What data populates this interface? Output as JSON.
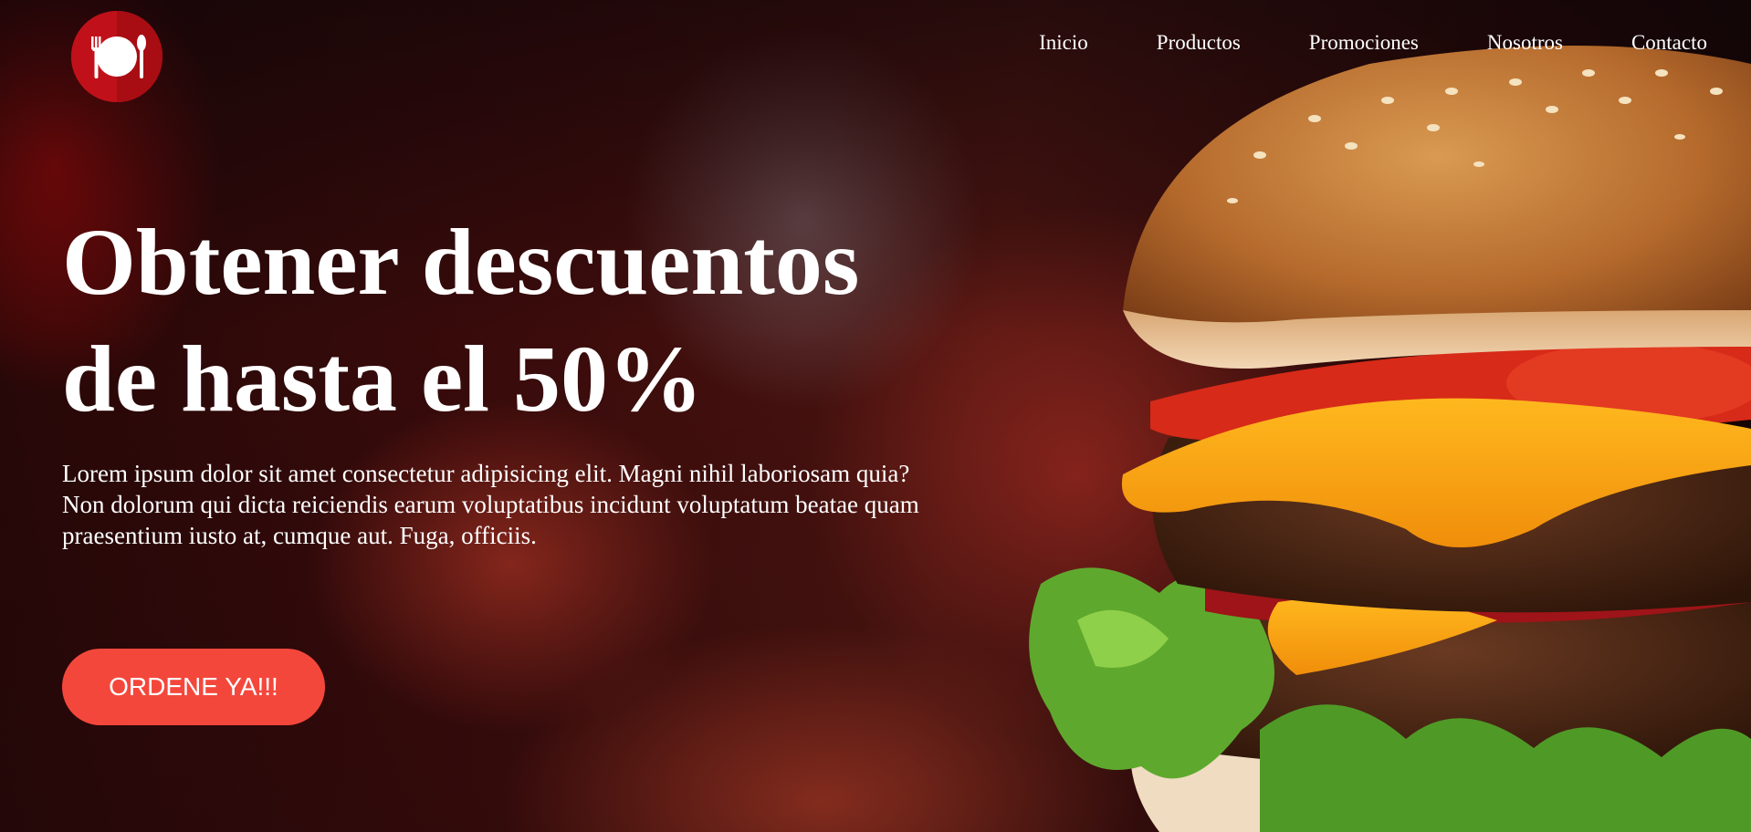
{
  "brand": {
    "logo_icon": "plate-cutlery-icon",
    "color": "#c0111a"
  },
  "nav": {
    "items": [
      {
        "label": "Inicio"
      },
      {
        "label": "Productos"
      },
      {
        "label": "Promociones"
      },
      {
        "label": "Nosotros"
      },
      {
        "label": "Contacto"
      }
    ]
  },
  "hero": {
    "headline_line1": "Obtener descuentos",
    "headline_line2": "de hasta el 50%",
    "lede": "Lorem ipsum dolor sit amet consectetur adipisicing elit. Magni nihil laboriosam quia? Non dolorum qui dicta reiciendis earum voluptatibus incidunt voluptatum beatae quam praesentium iusto at, cumque aut. Fuga, officiis.",
    "cta_label": "ORDENE YA!!!",
    "cta_color": "#f4473c",
    "image": "burger-photo"
  }
}
